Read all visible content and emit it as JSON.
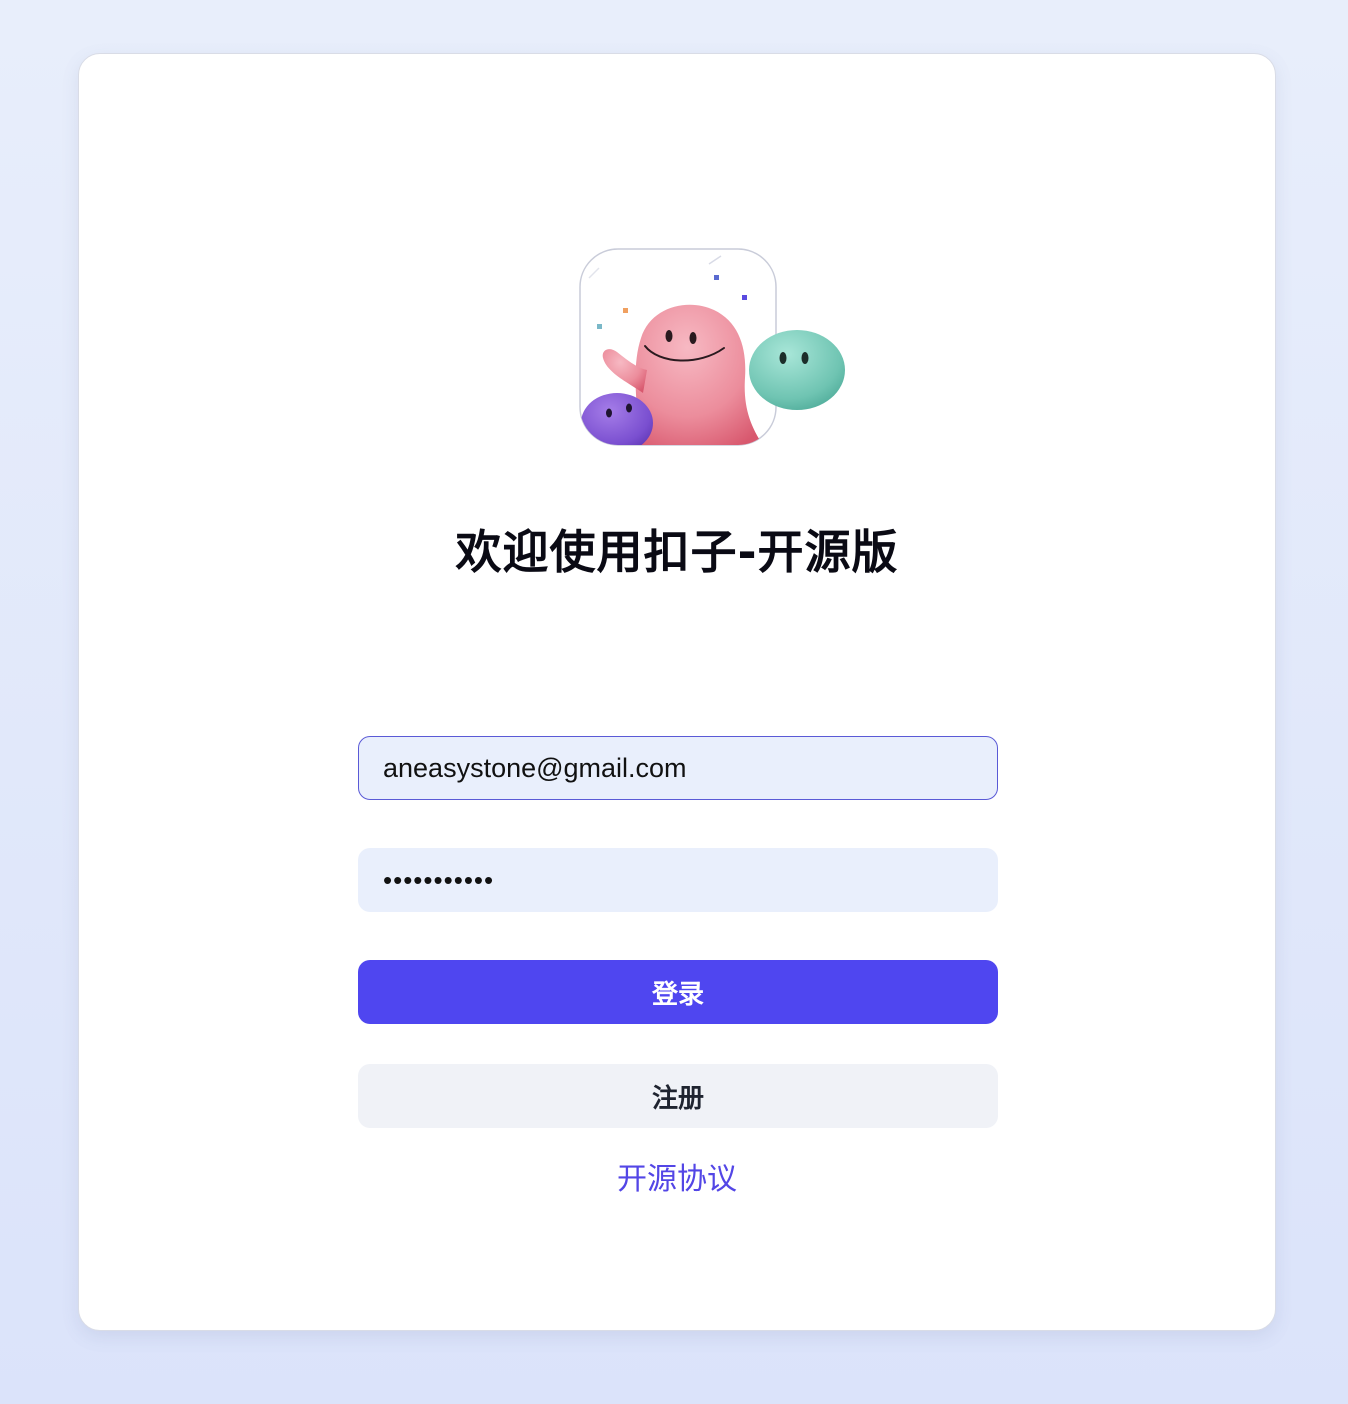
{
  "login": {
    "title": "欢迎使用扣子-开源版",
    "email": {
      "value": "aneasystone@gmail.com",
      "placeholder": ""
    },
    "password": {
      "value": "•••••••••••",
      "placeholder": ""
    },
    "login_button": "登录",
    "register_button": "注册",
    "agreement_link": "开源协议"
  },
  "colors": {
    "primary": "#4f46f0",
    "link": "#5346e6",
    "input_bg": "#e9effc",
    "input_focus_border": "#5a5ad6",
    "secondary_button_bg": "#f0f2f7",
    "page_bg": "#e3e9fb"
  },
  "icons": {
    "logo": "coze-mascot-logo"
  }
}
